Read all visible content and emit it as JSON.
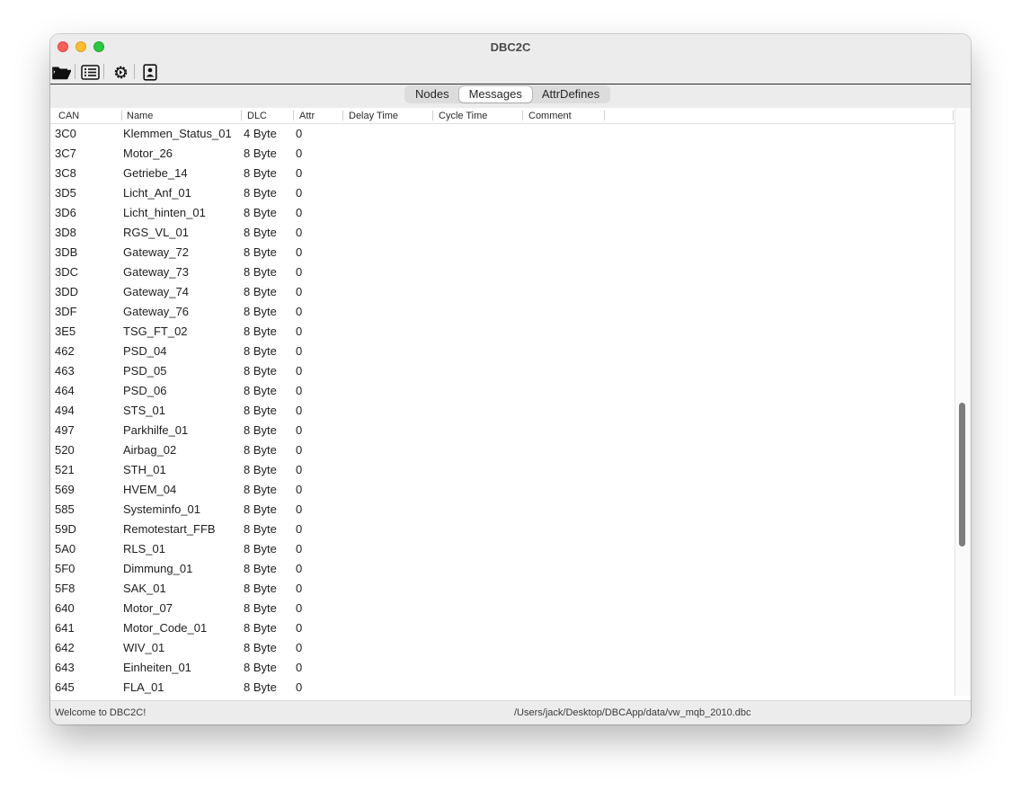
{
  "window": {
    "title": "DBC2C"
  },
  "toolbar": {
    "buttons": [
      {
        "icon": "folder-open-icon"
      },
      {
        "icon": "list-icon"
      },
      {
        "icon": "gear-icon"
      },
      {
        "icon": "contact-card-icon"
      }
    ]
  },
  "tabs": [
    {
      "label": "Nodes",
      "active": false
    },
    {
      "label": "Messages",
      "active": true
    },
    {
      "label": "AttrDefines",
      "active": false
    }
  ],
  "table": {
    "columns": [
      "CAN",
      "Name",
      "DLC",
      "Attr",
      "Delay Time",
      "Cycle Time",
      "Comment"
    ],
    "rows": [
      {
        "can": "3C0",
        "name": "Klemmen_Status_01",
        "dlc": "4 Byte",
        "attr": "0"
      },
      {
        "can": "3C7",
        "name": "Motor_26",
        "dlc": "8 Byte",
        "attr": "0"
      },
      {
        "can": "3C8",
        "name": "Getriebe_14",
        "dlc": "8 Byte",
        "attr": "0"
      },
      {
        "can": "3D5",
        "name": "Licht_Anf_01",
        "dlc": "8 Byte",
        "attr": "0"
      },
      {
        "can": "3D6",
        "name": "Licht_hinten_01",
        "dlc": "8 Byte",
        "attr": "0"
      },
      {
        "can": "3D8",
        "name": "RGS_VL_01",
        "dlc": "8 Byte",
        "attr": "0"
      },
      {
        "can": "3DB",
        "name": "Gateway_72",
        "dlc": "8 Byte",
        "attr": "0"
      },
      {
        "can": "3DC",
        "name": "Gateway_73",
        "dlc": "8 Byte",
        "attr": "0"
      },
      {
        "can": "3DD",
        "name": "Gateway_74",
        "dlc": "8 Byte",
        "attr": "0"
      },
      {
        "can": "3DF",
        "name": "Gateway_76",
        "dlc": "8 Byte",
        "attr": "0"
      },
      {
        "can": "3E5",
        "name": "TSG_FT_02",
        "dlc": "8 Byte",
        "attr": "0"
      },
      {
        "can": "462",
        "name": "PSD_04",
        "dlc": "8 Byte",
        "attr": "0"
      },
      {
        "can": "463",
        "name": "PSD_05",
        "dlc": "8 Byte",
        "attr": "0"
      },
      {
        "can": "464",
        "name": "PSD_06",
        "dlc": "8 Byte",
        "attr": "0"
      },
      {
        "can": "494",
        "name": "STS_01",
        "dlc": "8 Byte",
        "attr": "0"
      },
      {
        "can": "497",
        "name": "Parkhilfe_01",
        "dlc": "8 Byte",
        "attr": "0"
      },
      {
        "can": "520",
        "name": "Airbag_02",
        "dlc": "8 Byte",
        "attr": "0"
      },
      {
        "can": "521",
        "name": "STH_01",
        "dlc": "8 Byte",
        "attr": "0"
      },
      {
        "can": "569",
        "name": "HVEM_04",
        "dlc": "8 Byte",
        "attr": "0"
      },
      {
        "can": "585",
        "name": "Systeminfo_01",
        "dlc": "8 Byte",
        "attr": "0"
      },
      {
        "can": "59D",
        "name": "Remotestart_FFB",
        "dlc": "8 Byte",
        "attr": "0"
      },
      {
        "can": "5A0",
        "name": "RLS_01",
        "dlc": "8 Byte",
        "attr": "0"
      },
      {
        "can": "5F0",
        "name": "Dimmung_01",
        "dlc": "8 Byte",
        "attr": "0"
      },
      {
        "can": "5F8",
        "name": "SAK_01",
        "dlc": "8 Byte",
        "attr": "0"
      },
      {
        "can": "640",
        "name": "Motor_07",
        "dlc": "8 Byte",
        "attr": "0"
      },
      {
        "can": "641",
        "name": "Motor_Code_01",
        "dlc": "8 Byte",
        "attr": "0"
      },
      {
        "can": "642",
        "name": "WIV_01",
        "dlc": "8 Byte",
        "attr": "0"
      },
      {
        "can": "643",
        "name": "Einheiten_01",
        "dlc": "8 Byte",
        "attr": "0"
      },
      {
        "can": "645",
        "name": "FLA_01",
        "dlc": "8 Byte",
        "attr": "0"
      }
    ]
  },
  "status": {
    "message": "Welcome to DBC2C!",
    "path": "/Users/jack/Desktop/DBCApp/data/vw_mqb_2010.dbc"
  },
  "colors": {
    "close": "#fe5f57",
    "minimize": "#febc2e",
    "maximize": "#28c840",
    "chrome": "#ececec"
  }
}
